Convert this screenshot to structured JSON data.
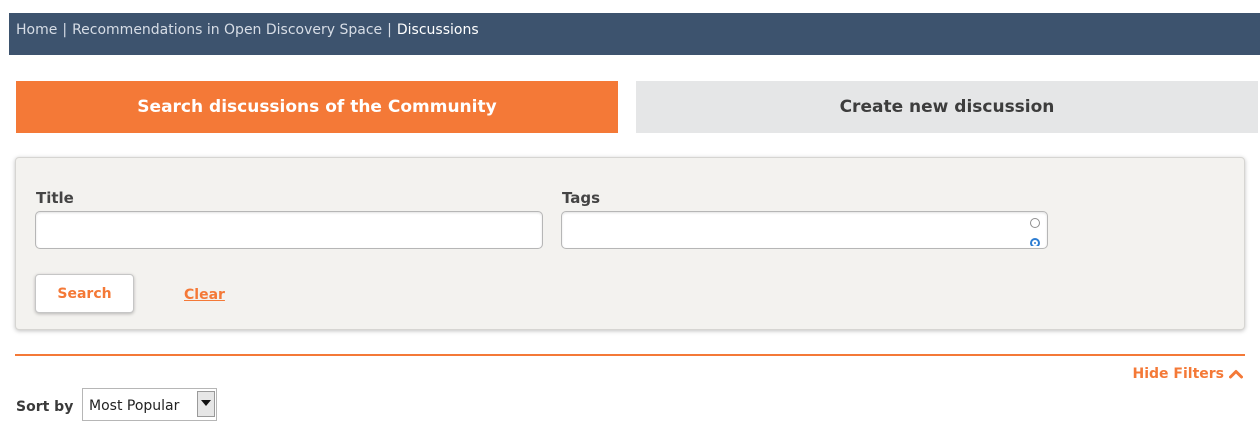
{
  "breadcrumb": {
    "items": [
      {
        "label": "Home"
      },
      {
        "label": "Recommendations in Open Discovery Space"
      },
      {
        "label": "Discussions"
      }
    ],
    "separator": "|"
  },
  "tabs": [
    {
      "label": "Search discussions of the Community",
      "active": true
    },
    {
      "label": "Create new discussion",
      "active": false
    }
  ],
  "filters": {
    "title_label": "Title",
    "title_value": "",
    "tags_label": "Tags",
    "tags_value": "",
    "search_label": "Search",
    "clear_label": "Clear"
  },
  "hide_filters_label": "Hide Filters",
  "sort": {
    "label": "Sort by",
    "selected": "Most Popular"
  },
  "colors": {
    "accent": "#f47937",
    "breadcrumb_bg": "#3d536e",
    "inactive_tab_bg": "#e5e6e7",
    "panel_bg": "#f3f2ef"
  },
  "icons": {
    "hide_filters": "chevron-up-icon",
    "sort_dropdown": "caret-down-icon"
  }
}
